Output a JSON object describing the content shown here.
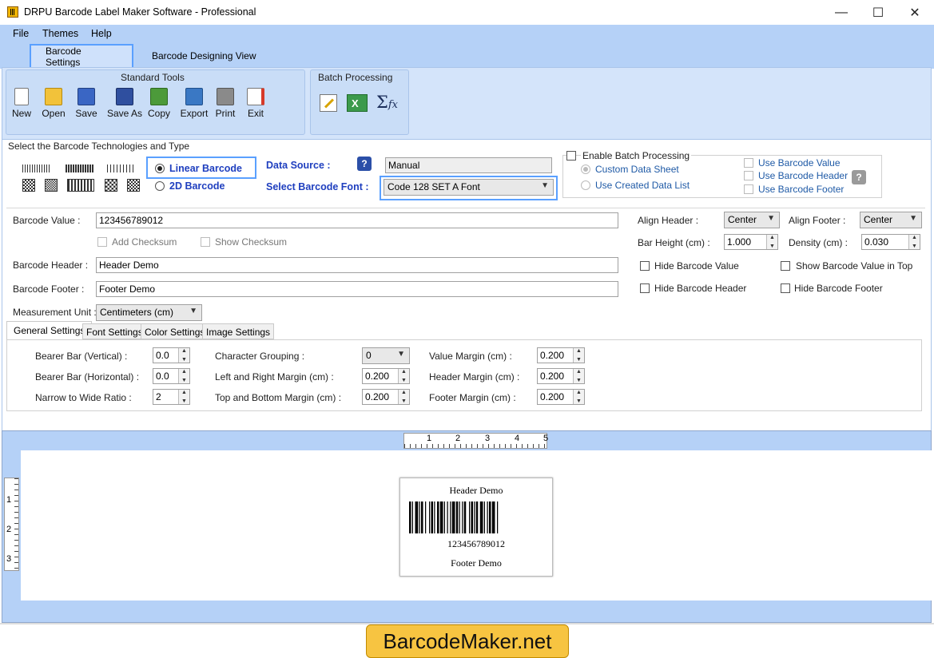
{
  "window": {
    "title": "DRPU Barcode Label Maker Software - Professional",
    "minimize": "—",
    "maximize": "☐",
    "close": "✕"
  },
  "menu": {
    "file": "File",
    "themes": "Themes",
    "help": "Help"
  },
  "tabs": {
    "barcode_settings": "Barcode Settings",
    "designing_view": "Barcode Designing View"
  },
  "standard_tools": {
    "title": "Standard Tools",
    "items": [
      {
        "label": "New",
        "icon": "new-document-icon",
        "color": "#ffffff"
      },
      {
        "label": "Open",
        "icon": "open-folder-icon",
        "color": "#f2c23a"
      },
      {
        "label": "Save",
        "icon": "save-disk-icon",
        "color": "#3a66c4"
      },
      {
        "label": "Save As",
        "icon": "save-as-icon",
        "color": "#2f4f9f"
      },
      {
        "label": "Copy",
        "icon": "copy-icon",
        "color": "#4c9a3a"
      },
      {
        "label": "Export",
        "icon": "export-icon",
        "color": "#3a78c4"
      },
      {
        "label": "Print",
        "icon": "print-icon",
        "color": "#8a8a8a"
      },
      {
        "label": "Exit",
        "icon": "exit-icon",
        "color": "#d63a2a"
      }
    ]
  },
  "batch_processing": {
    "title": "Batch Processing",
    "icons": [
      "edit-batch-icon",
      "excel-import-icon",
      "sigma-fx-icon"
    ],
    "sigma": "Σ",
    "fx": "fx"
  },
  "technologies": {
    "section_label": "Select the Barcode Technologies and Type",
    "linear": "Linear Barcode",
    "two_d": "2D Barcode",
    "selected": "Linear Barcode"
  },
  "data_source": {
    "label": "Data Source :",
    "value": "Manual",
    "help": "?"
  },
  "barcode_font": {
    "label": "Select Barcode Font :",
    "value": "Code 128 SET A Font"
  },
  "batch": {
    "enable": "Enable Batch Processing",
    "custom_sheet": "Custom Data Sheet",
    "created_list": "Use Created Data List",
    "use_value": "Use Barcode Value",
    "use_header": "Use Barcode Header",
    "use_footer": "Use Barcode Footer",
    "help": "?"
  },
  "fields": {
    "value_label": "Barcode Value :",
    "value": "123456789012",
    "add_checksum": "Add Checksum",
    "show_checksum": "Show Checksum",
    "header_label": "Barcode Header :",
    "header": "Header Demo",
    "footer_label": "Barcode Footer :",
    "footer": "Footer Demo",
    "unit_label": "Measurement Unit :",
    "unit": "Centimeters (cm)"
  },
  "right_options": {
    "align_header_label": "Align Header :",
    "align_header": "Center",
    "align_footer_label": "Align Footer :",
    "align_footer": "Center",
    "bar_height_label": "Bar Height (cm) :",
    "bar_height": "1.000",
    "density_label": "Density (cm) :",
    "density": "0.030",
    "hide_value": "Hide Barcode Value",
    "show_value_top": "Show Barcode Value in Top",
    "hide_header": "Hide Barcode Header",
    "hide_footer": "Hide Barcode Footer"
  },
  "subtabs": {
    "general": "General Settings",
    "font": "Font Settings",
    "color": "Color Settings",
    "image": "Image Settings"
  },
  "general": {
    "bearer_v_label": "Bearer Bar (Vertical) :",
    "bearer_v": "0.0",
    "bearer_h_label": "Bearer Bar (Horizontal) :",
    "bearer_h": "0.0",
    "ratio_label": "Narrow to Wide Ratio :",
    "ratio": "2",
    "char_group_label": "Character Grouping :",
    "char_group": "0",
    "lr_margin_label": "Left and Right Margin (cm) :",
    "lr_margin": "0.200",
    "tb_margin_label": "Top and Bottom Margin (cm) :",
    "tb_margin": "0.200",
    "value_margin_label": "Value Margin (cm) :",
    "value_margin": "0.200",
    "header_margin_label": "Header Margin (cm) :",
    "header_margin": "0.200",
    "footer_margin_label": "Footer Margin (cm) :",
    "footer_margin": "0.200"
  },
  "preview": {
    "header": "Header Demo",
    "value": "123456789012",
    "footer": "Footer Demo",
    "ruler_h": [
      "1",
      "2",
      "3",
      "4",
      "5"
    ],
    "ruler_v": [
      "1",
      "2",
      "3"
    ]
  },
  "brand": "BarcodeMaker.net"
}
